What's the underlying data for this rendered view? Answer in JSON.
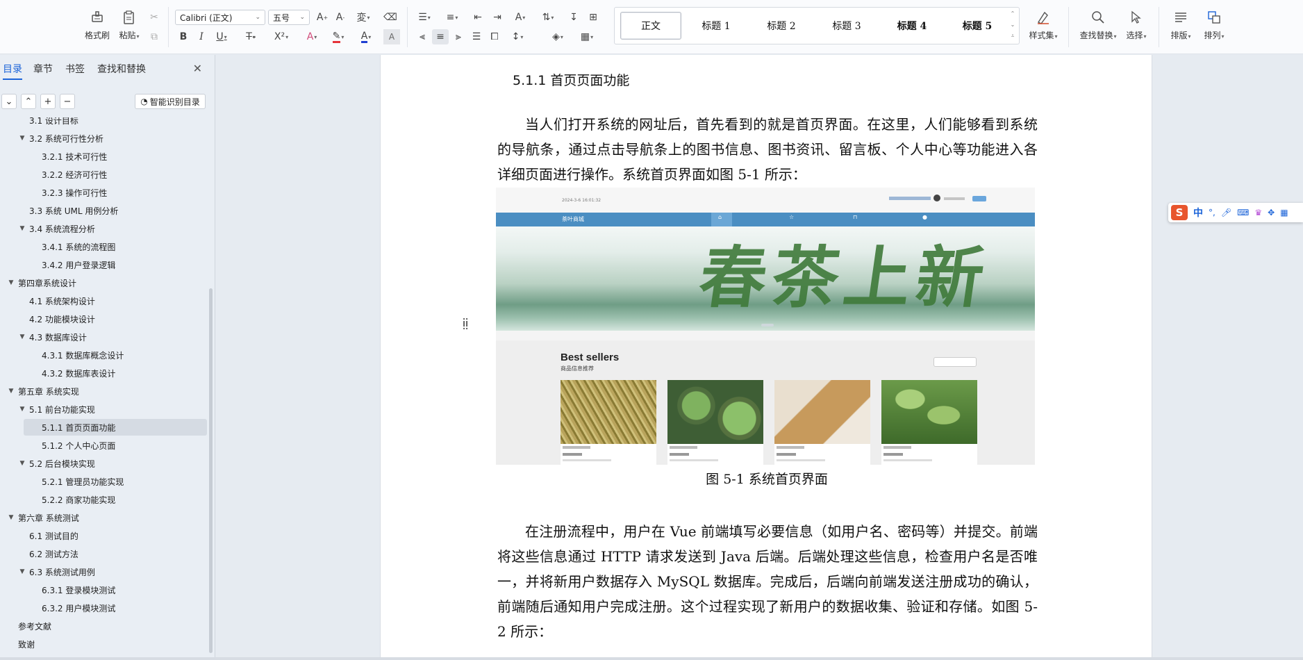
{
  "ribbon": {
    "format_painter": "格式刷",
    "paste": "粘贴",
    "font_name": "Calibri (正文)",
    "font_size": "五号",
    "styles": [
      {
        "label": "正文",
        "selected": true,
        "bold": false
      },
      {
        "label": "标题  1",
        "selected": false,
        "bold": false
      },
      {
        "label": "标题  2",
        "selected": false,
        "bold": false
      },
      {
        "label": "标题  3",
        "selected": false,
        "bold": false
      },
      {
        "label": "标题 4",
        "selected": false,
        "bold": true
      },
      {
        "label": "标题  5",
        "selected": false,
        "bold": true
      }
    ],
    "style_set": "样式集",
    "find_replace": "查找替换",
    "select": "选择",
    "layout": "排版",
    "arrange": "排列",
    "colors": {
      "highlight": "#e5333a",
      "font_color": "#1f3fd1"
    }
  },
  "nav": {
    "tabs": [
      "目录",
      "章节",
      "书签",
      "查找和替换"
    ],
    "active_tab": "目录",
    "smart_toc": "智能识别目录",
    "items": [
      {
        "label": "3.1 设计目标",
        "level": 2,
        "expand": false
      },
      {
        "label": "3.2 系统可行性分析",
        "level": 2,
        "expand": true
      },
      {
        "label": "3.2.1 技术可行性",
        "level": 3,
        "expand": false
      },
      {
        "label": "3.2.2 经济可行性",
        "level": 3,
        "expand": false
      },
      {
        "label": "3.2.3 操作可行性",
        "level": 3,
        "expand": false
      },
      {
        "label": "3.3 系统 UML 用例分析",
        "level": 2,
        "expand": false
      },
      {
        "label": "3.4 系统流程分析",
        "level": 2,
        "expand": true
      },
      {
        "label": "3.4.1 系统的流程图",
        "level": 3,
        "expand": false
      },
      {
        "label": "3.4.2 用户登录逻辑",
        "level": 3,
        "expand": false
      },
      {
        "label": "第四章系统设计",
        "level": 1,
        "expand": true
      },
      {
        "label": "4.1  系统架构设计",
        "level": 2,
        "expand": false
      },
      {
        "label": "4.2 功能模块设计",
        "level": 2,
        "expand": false
      },
      {
        "label": "4.3  数据库设计",
        "level": 2,
        "expand": true
      },
      {
        "label": "4.3.1 数据库概念设计",
        "level": 3,
        "expand": false
      },
      {
        "label": "4.3.2  数据库表设计",
        "level": 3,
        "expand": false
      },
      {
        "label": "第五章  系统实现",
        "level": 1,
        "expand": true
      },
      {
        "label": "5.1 前台功能实现",
        "level": 2,
        "expand": true
      },
      {
        "label": "5.1.1 首页页面功能",
        "level": 3,
        "expand": false,
        "selected": true
      },
      {
        "label": "5.1.2 个人中心页面",
        "level": 3,
        "expand": false
      },
      {
        "label": "5.2 后台模块实现",
        "level": 2,
        "expand": true
      },
      {
        "label": "5.2.1 管理员功能实现",
        "level": 3,
        "expand": false
      },
      {
        "label": "5.2.2 商家功能实现",
        "level": 3,
        "expand": false
      },
      {
        "label": "第六章  系统测试",
        "level": 1,
        "expand": true
      },
      {
        "label": "6.1 测试目的",
        "level": 2,
        "expand": false
      },
      {
        "label": "6.2 测试方法",
        "level": 2,
        "expand": false
      },
      {
        "label": "6.3 系统测试用例",
        "level": 2,
        "expand": true
      },
      {
        "label": "6.3.1 登录模块测试",
        "level": 3,
        "expand": false
      },
      {
        "label": "6.3.2 用户模块测试",
        "level": 3,
        "expand": false
      },
      {
        "label": "参考文献",
        "level": 1,
        "expand": false
      },
      {
        "label": "致谢",
        "level": 1,
        "expand": false
      }
    ]
  },
  "document": {
    "heading": "5.1.1 首页页面功能",
    "para1": "当人们打开系统的网址后，首先看到的就是首页界面。在这里，人们能够看到系统的导航条，通过点击导航条上的图书信息、图书资讯、留言板、个人中心等功能进入各详细页面进行操作。系统首页界面如图 5-1 所示：",
    "figure": {
      "timestamp": "2024-3-6 16:01:32",
      "site_name": "茶叶商城",
      "banner_text": "春茶上新",
      "section_title": "Best sellers",
      "section_subtitle": "商品信息推荐",
      "product_images": [
        "tea-leaves-dry",
        "tea-drying-baskets",
        "tea-box",
        "tea-plants"
      ]
    },
    "caption": "图 5-1  系统首页界面",
    "para2": "在注册流程中，用户在 Vue 前端填写必要信息（如用户名、密码等）并提交。前端将这些信息通过 HTTP 请求发送到 Java 后端。后端处理这些信息，检查用户名是否唯一，并将新用户数据存入 MySQL 数据库。完成后，后端向前端发送注册成功的确认，前端随后通知用户完成注册。这个过程实现了新用户的数据收集、验证和存储。如图 5-2 所示："
  },
  "ime": {
    "logo": "S",
    "mode": "中"
  }
}
